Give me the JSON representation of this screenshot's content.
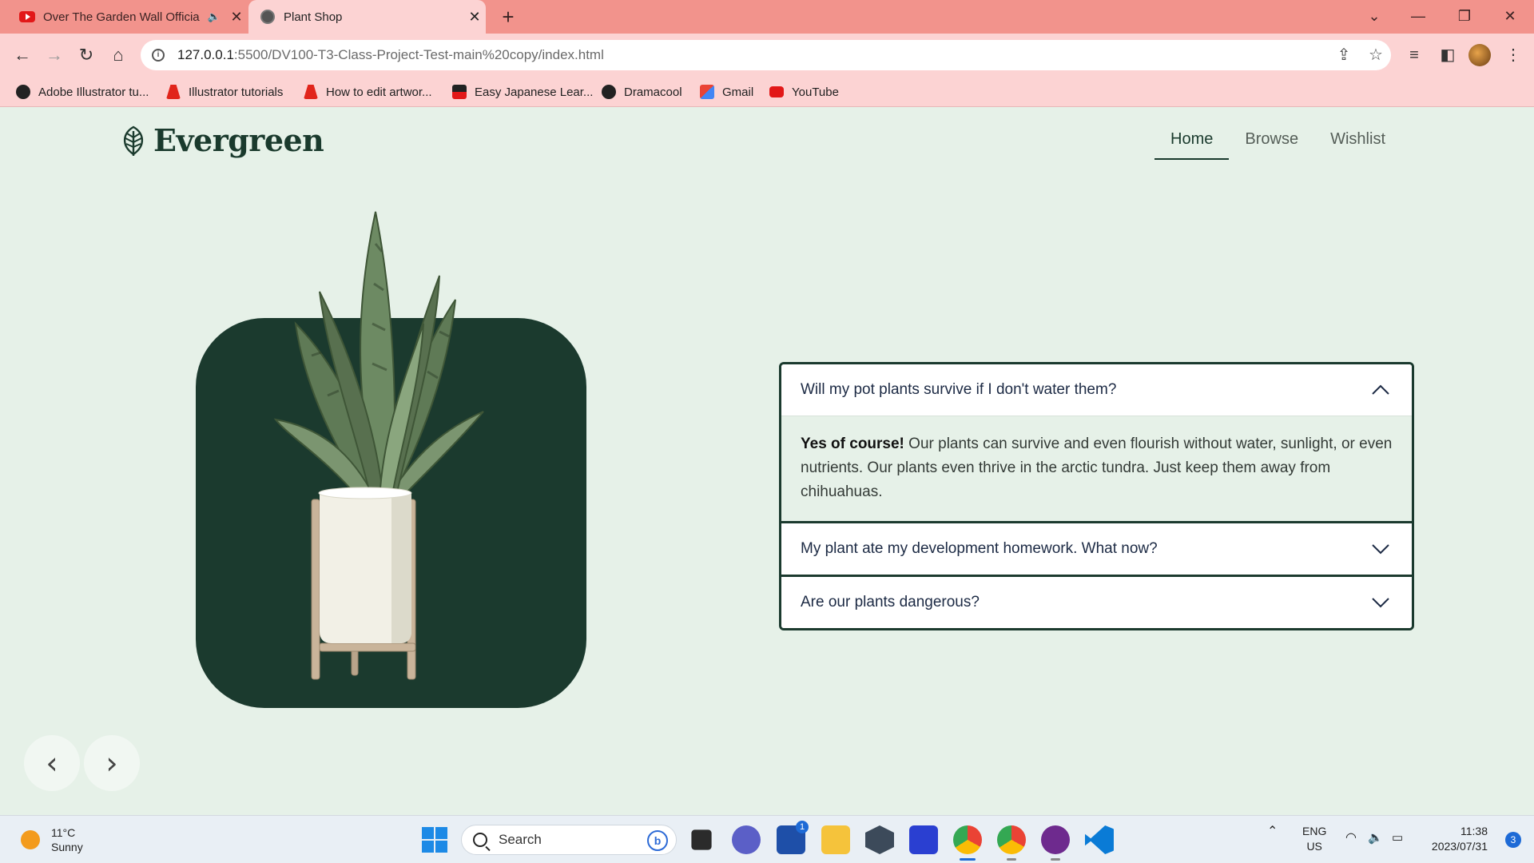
{
  "browser": {
    "tabs": [
      {
        "title": "Over The Garden Wall Officia",
        "icon": "youtube-icon",
        "audio": true
      },
      {
        "title": "Plant Shop",
        "icon": "globe-icon",
        "active": true
      }
    ],
    "url_host": "127.0.0.1",
    "url_path": ":5500/DV100-T3-Class-Project-Test-main%20copy/index.html",
    "bookmarks": [
      {
        "label": "Adobe Illustrator tu...",
        "icon": "globe-icon"
      },
      {
        "label": "Illustrator tutorials",
        "icon": "adobe-icon"
      },
      {
        "label": "How to edit artwor...",
        "icon": "adobe-icon"
      },
      {
        "label": "Easy Japanese Lear...",
        "icon": "nhk-icon"
      },
      {
        "label": "Dramacool",
        "icon": "globe-icon"
      },
      {
        "label": "Gmail",
        "icon": "gmail-icon"
      },
      {
        "label": "YouTube",
        "icon": "youtube-icon"
      }
    ]
  },
  "site": {
    "brand": "Evergreen",
    "nav": [
      {
        "label": "Home",
        "active": true
      },
      {
        "label": "Browse"
      },
      {
        "label": "Wishlist"
      }
    ],
    "faq": [
      {
        "question": "Will my pot plants survive if I don't water them?",
        "expanded": true,
        "answer_bold": "Yes of course!",
        "answer_text": " Our plants can survive and even flourish without water, sunlight, or even nutrients. Our plants even thrive in the arctic tundra. Just keep them away from chihuahuas."
      },
      {
        "question": "My plant ate my development homework. What now?",
        "expanded": false
      },
      {
        "question": "Are our plants dangerous?",
        "expanded": false
      }
    ],
    "colors": {
      "dark_green": "#1b3a2e",
      "background": "#e6f1e8"
    }
  },
  "taskbar": {
    "weather_temp": "11°C",
    "weather_desc": "Sunny",
    "search_placeholder": "Search",
    "store_badge": "1",
    "lang_1": "ENG",
    "lang_2": "US",
    "time": "11:38",
    "date": "2023/07/31",
    "notifications": "3"
  }
}
